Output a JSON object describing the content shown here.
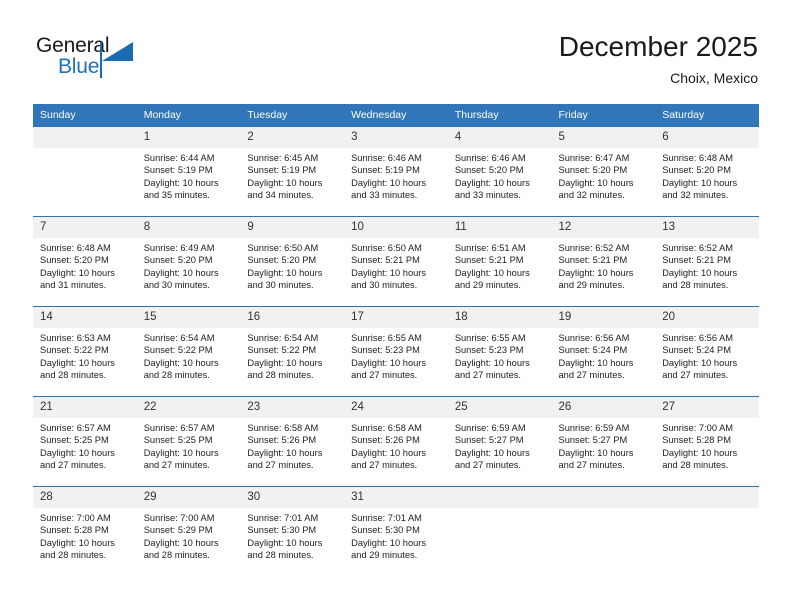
{
  "brand": {
    "name_top": "General",
    "name_bottom": "Blue",
    "accent_color": "#1a6cb0"
  },
  "header": {
    "title": "December 2025",
    "subtitle": "Choix, Mexico"
  },
  "theme": {
    "header_row_bg": "#3076b8",
    "daynum_bg": "#f1f1f1",
    "row_border": "#2f72b0"
  },
  "weekday_headers": [
    "Sunday",
    "Monday",
    "Tuesday",
    "Wednesday",
    "Thursday",
    "Friday",
    "Saturday"
  ],
  "weeks": [
    [
      {
        "day": "",
        "sunrise": "",
        "sunset": "",
        "daylight_line1": "",
        "daylight_line2": ""
      },
      {
        "day": "1",
        "sunrise": "Sunrise: 6:44 AM",
        "sunset": "Sunset: 5:19 PM",
        "daylight_line1": "Daylight: 10 hours",
        "daylight_line2": "and 35 minutes."
      },
      {
        "day": "2",
        "sunrise": "Sunrise: 6:45 AM",
        "sunset": "Sunset: 5:19 PM",
        "daylight_line1": "Daylight: 10 hours",
        "daylight_line2": "and 34 minutes."
      },
      {
        "day": "3",
        "sunrise": "Sunrise: 6:46 AM",
        "sunset": "Sunset: 5:19 PM",
        "daylight_line1": "Daylight: 10 hours",
        "daylight_line2": "and 33 minutes."
      },
      {
        "day": "4",
        "sunrise": "Sunrise: 6:46 AM",
        "sunset": "Sunset: 5:20 PM",
        "daylight_line1": "Daylight: 10 hours",
        "daylight_line2": "and 33 minutes."
      },
      {
        "day": "5",
        "sunrise": "Sunrise: 6:47 AM",
        "sunset": "Sunset: 5:20 PM",
        "daylight_line1": "Daylight: 10 hours",
        "daylight_line2": "and 32 minutes."
      },
      {
        "day": "6",
        "sunrise": "Sunrise: 6:48 AM",
        "sunset": "Sunset: 5:20 PM",
        "daylight_line1": "Daylight: 10 hours",
        "daylight_line2": "and 32 minutes."
      }
    ],
    [
      {
        "day": "7",
        "sunrise": "Sunrise: 6:48 AM",
        "sunset": "Sunset: 5:20 PM",
        "daylight_line1": "Daylight: 10 hours",
        "daylight_line2": "and 31 minutes."
      },
      {
        "day": "8",
        "sunrise": "Sunrise: 6:49 AM",
        "sunset": "Sunset: 5:20 PM",
        "daylight_line1": "Daylight: 10 hours",
        "daylight_line2": "and 30 minutes."
      },
      {
        "day": "9",
        "sunrise": "Sunrise: 6:50 AM",
        "sunset": "Sunset: 5:20 PM",
        "daylight_line1": "Daylight: 10 hours",
        "daylight_line2": "and 30 minutes."
      },
      {
        "day": "10",
        "sunrise": "Sunrise: 6:50 AM",
        "sunset": "Sunset: 5:21 PM",
        "daylight_line1": "Daylight: 10 hours",
        "daylight_line2": "and 30 minutes."
      },
      {
        "day": "11",
        "sunrise": "Sunrise: 6:51 AM",
        "sunset": "Sunset: 5:21 PM",
        "daylight_line1": "Daylight: 10 hours",
        "daylight_line2": "and 29 minutes."
      },
      {
        "day": "12",
        "sunrise": "Sunrise: 6:52 AM",
        "sunset": "Sunset: 5:21 PM",
        "daylight_line1": "Daylight: 10 hours",
        "daylight_line2": "and 29 minutes."
      },
      {
        "day": "13",
        "sunrise": "Sunrise: 6:52 AM",
        "sunset": "Sunset: 5:21 PM",
        "daylight_line1": "Daylight: 10 hours",
        "daylight_line2": "and 28 minutes."
      }
    ],
    [
      {
        "day": "14",
        "sunrise": "Sunrise: 6:53 AM",
        "sunset": "Sunset: 5:22 PM",
        "daylight_line1": "Daylight: 10 hours",
        "daylight_line2": "and 28 minutes."
      },
      {
        "day": "15",
        "sunrise": "Sunrise: 6:54 AM",
        "sunset": "Sunset: 5:22 PM",
        "daylight_line1": "Daylight: 10 hours",
        "daylight_line2": "and 28 minutes."
      },
      {
        "day": "16",
        "sunrise": "Sunrise: 6:54 AM",
        "sunset": "Sunset: 5:22 PM",
        "daylight_line1": "Daylight: 10 hours",
        "daylight_line2": "and 28 minutes."
      },
      {
        "day": "17",
        "sunrise": "Sunrise: 6:55 AM",
        "sunset": "Sunset: 5:23 PM",
        "daylight_line1": "Daylight: 10 hours",
        "daylight_line2": "and 27 minutes."
      },
      {
        "day": "18",
        "sunrise": "Sunrise: 6:55 AM",
        "sunset": "Sunset: 5:23 PM",
        "daylight_line1": "Daylight: 10 hours",
        "daylight_line2": "and 27 minutes."
      },
      {
        "day": "19",
        "sunrise": "Sunrise: 6:56 AM",
        "sunset": "Sunset: 5:24 PM",
        "daylight_line1": "Daylight: 10 hours",
        "daylight_line2": "and 27 minutes."
      },
      {
        "day": "20",
        "sunrise": "Sunrise: 6:56 AM",
        "sunset": "Sunset: 5:24 PM",
        "daylight_line1": "Daylight: 10 hours",
        "daylight_line2": "and 27 minutes."
      }
    ],
    [
      {
        "day": "21",
        "sunrise": "Sunrise: 6:57 AM",
        "sunset": "Sunset: 5:25 PM",
        "daylight_line1": "Daylight: 10 hours",
        "daylight_line2": "and 27 minutes."
      },
      {
        "day": "22",
        "sunrise": "Sunrise: 6:57 AM",
        "sunset": "Sunset: 5:25 PM",
        "daylight_line1": "Daylight: 10 hours",
        "daylight_line2": "and 27 minutes."
      },
      {
        "day": "23",
        "sunrise": "Sunrise: 6:58 AM",
        "sunset": "Sunset: 5:26 PM",
        "daylight_line1": "Daylight: 10 hours",
        "daylight_line2": "and 27 minutes."
      },
      {
        "day": "24",
        "sunrise": "Sunrise: 6:58 AM",
        "sunset": "Sunset: 5:26 PM",
        "daylight_line1": "Daylight: 10 hours",
        "daylight_line2": "and 27 minutes."
      },
      {
        "day": "25",
        "sunrise": "Sunrise: 6:59 AM",
        "sunset": "Sunset: 5:27 PM",
        "daylight_line1": "Daylight: 10 hours",
        "daylight_line2": "and 27 minutes."
      },
      {
        "day": "26",
        "sunrise": "Sunrise: 6:59 AM",
        "sunset": "Sunset: 5:27 PM",
        "daylight_line1": "Daylight: 10 hours",
        "daylight_line2": "and 27 minutes."
      },
      {
        "day": "27",
        "sunrise": "Sunrise: 7:00 AM",
        "sunset": "Sunset: 5:28 PM",
        "daylight_line1": "Daylight: 10 hours",
        "daylight_line2": "and 28 minutes."
      }
    ],
    [
      {
        "day": "28",
        "sunrise": "Sunrise: 7:00 AM",
        "sunset": "Sunset: 5:28 PM",
        "daylight_line1": "Daylight: 10 hours",
        "daylight_line2": "and 28 minutes."
      },
      {
        "day": "29",
        "sunrise": "Sunrise: 7:00 AM",
        "sunset": "Sunset: 5:29 PM",
        "daylight_line1": "Daylight: 10 hours",
        "daylight_line2": "and 28 minutes."
      },
      {
        "day": "30",
        "sunrise": "Sunrise: 7:01 AM",
        "sunset": "Sunset: 5:30 PM",
        "daylight_line1": "Daylight: 10 hours",
        "daylight_line2": "and 28 minutes."
      },
      {
        "day": "31",
        "sunrise": "Sunrise: 7:01 AM",
        "sunset": "Sunset: 5:30 PM",
        "daylight_line1": "Daylight: 10 hours",
        "daylight_line2": "and 29 minutes."
      },
      {
        "day": "",
        "sunrise": "",
        "sunset": "",
        "daylight_line1": "",
        "daylight_line2": ""
      },
      {
        "day": "",
        "sunrise": "",
        "sunset": "",
        "daylight_line1": "",
        "daylight_line2": ""
      },
      {
        "day": "",
        "sunrise": "",
        "sunset": "",
        "daylight_line1": "",
        "daylight_line2": ""
      }
    ]
  ]
}
